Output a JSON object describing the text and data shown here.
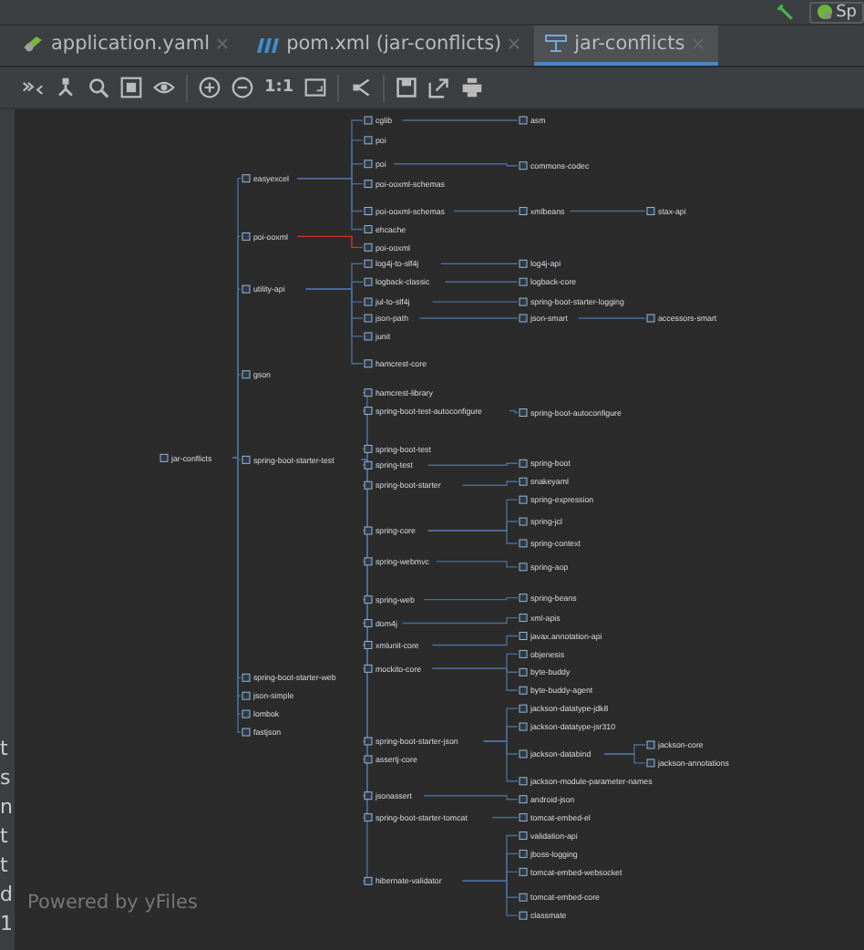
{
  "header": {
    "run_label": "Sp"
  },
  "tabs": [
    {
      "label": "application.yaml",
      "selected": false
    },
    {
      "label": "pom.xml (jar-conflicts)",
      "selected": false
    },
    {
      "label": "jar-conflicts",
      "selected": true
    }
  ],
  "toolbar": {
    "actual_size_label": "1:1"
  },
  "left_panel_fragments": [
    "t",
    "s",
    "n",
    "t",
    "t",
    "d",
    "1"
  ],
  "graph": {
    "nodes": [
      {
        "label": "jar-conflicts",
        "children": [
          {
            "label": "easyexcel",
            "children": [
              {
                "label": "cglib",
                "children": [
                  {
                    "label": "asm"
                  }
                ]
              },
              {
                "label": "poi"
              },
              {
                "label": "poi",
                "children": [
                  {
                    "label": "commons-codec"
                  }
                ]
              },
              {
                "label": "poi-ooxml-schemas"
              },
              {
                "label": "poi-ooxml-schemas",
                "children": [
                  {
                    "label": "xmlbeans",
                    "children": [
                      {
                        "label": "stax-api"
                      }
                    ]
                  }
                ]
              },
              {
                "label": "ehcache"
              }
            ]
          },
          {
            "label": "poi-ooxml",
            "children": [
              {
                "label": "poi-ooxml",
                "conflict": true
              }
            ]
          },
          {
            "label": "utility-api",
            "children": [
              {
                "label": "log4j-to-slf4j",
                "children": [
                  {
                    "label": "log4j-api"
                  }
                ]
              },
              {
                "label": "logback-classic",
                "children": [
                  {
                    "label": "logback-core"
                  }
                ]
              },
              {
                "label": "jul-to-slf4j",
                "children": [
                  {
                    "label": "spring-boot-starter-logging"
                  }
                ]
              },
              {
                "label": "json-path",
                "children": [
                  {
                    "label": "json-smart",
                    "children": [
                      {
                        "label": "accessors-smart"
                      }
                    ]
                  }
                ]
              },
              {
                "label": "junit"
              },
              {
                "label": "hamcrest-core"
              }
            ]
          },
          {
            "label": "gson"
          },
          {
            "label": "spring-boot-starter-test",
            "children": [
              {
                "label": "hamcrest-library"
              },
              {
                "label": "spring-boot-test-autoconfigure",
                "children": [
                  {
                    "label": "spring-boot-autoconfigure"
                  }
                ]
              },
              {
                "label": "spring-boot-test"
              },
              {
                "label": "spring-test",
                "children": [
                  {
                    "label": "spring-boot"
                  }
                ]
              },
              {
                "label": "spring-boot-starter",
                "children": [
                  {
                    "label": "snakeyaml"
                  }
                ]
              },
              {
                "label": "spring-core",
                "children": [
                  {
                    "label": "spring-expression"
                  },
                  {
                    "label": "spring-jcl"
                  },
                  {
                    "label": "spring-context"
                  }
                ]
              },
              {
                "label": "spring-webmvc",
                "children": [
                  {
                    "label": "spring-aop"
                  }
                ]
              },
              {
                "label": "spring-web",
                "children": [
                  {
                    "label": "spring-beans"
                  }
                ]
              },
              {
                "label": "dom4j",
                "children": [
                  {
                    "label": "xml-apis"
                  }
                ]
              },
              {
                "label": "xmlunit-core",
                "children": [
                  {
                    "label": "javax.annotation-api"
                  }
                ]
              },
              {
                "label": "mockito-core",
                "children": [
                  {
                    "label": "objenesis"
                  },
                  {
                    "label": "byte-buddy"
                  },
                  {
                    "label": "byte-buddy-agent"
                  }
                ]
              },
              {
                "label": "spring-boot-starter-json",
                "children": [
                  {
                    "label": "jackson-datatype-jdk8"
                  },
                  {
                    "label": "jackson-datatype-jsr310"
                  },
                  {
                    "label": "jackson-databind",
                    "children": [
                      {
                        "label": "jackson-core"
                      },
                      {
                        "label": "jackson-annotations"
                      }
                    ]
                  },
                  {
                    "label": "jackson-module-parameter-names"
                  }
                ]
              },
              {
                "label": "assertj-core"
              },
              {
                "label": "jsonassert",
                "children": [
                  {
                    "label": "android-json"
                  }
                ]
              },
              {
                "label": "spring-boot-starter-tomcat",
                "children": [
                  {
                    "label": "tomcat-embed-el"
                  }
                ]
              },
              {
                "label": "hibernate-validator",
                "children": [
                  {
                    "label": "validation-api"
                  },
                  {
                    "label": "jboss-logging"
                  },
                  {
                    "label": "tomcat-embed-websocket"
                  },
                  {
                    "label": "tomcat-embed-core"
                  },
                  {
                    "label": "classmate"
                  }
                ]
              }
            ]
          },
          {
            "label": "spring-boot-starter-web"
          },
          {
            "label": "json-simple"
          },
          {
            "label": "lombok"
          },
          {
            "label": "fastjson"
          }
        ]
      }
    ]
  },
  "footer": {
    "credit": "Powered by yFiles"
  }
}
